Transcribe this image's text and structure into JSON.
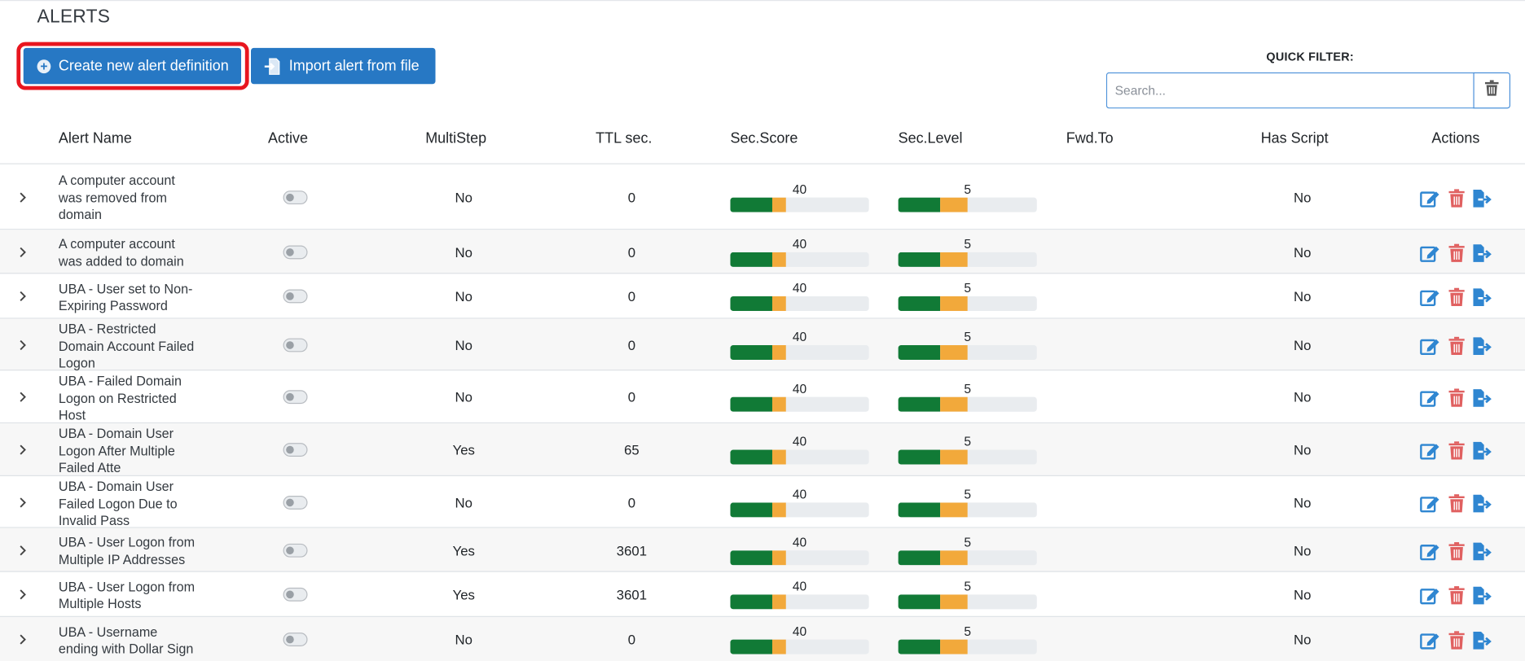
{
  "page": {
    "title": "ALERTS"
  },
  "toolbar": {
    "create_label": "Create new alert definition",
    "import_label": "Import alert from file"
  },
  "quick_filter": {
    "label": "QUICK FILTER:",
    "placeholder": "Search..."
  },
  "columns": {
    "name": "Alert Name",
    "active": "Active",
    "multistep": "MultiStep",
    "ttl": "TTL sec.",
    "sec_score": "Sec.Score",
    "sec_level": "Sec.Level",
    "fwd_to": "Fwd.To",
    "has_script": "Has Script",
    "actions": "Actions"
  },
  "colors": {
    "primary": "#2778c4",
    "highlight": "#e8161f",
    "bar_green": "#117a36",
    "bar_orange": "#f2a93b",
    "edit_icon": "#2f86d1",
    "delete_icon": "#e06060"
  },
  "icons": [
    "plus-circle-icon",
    "import-file-icon",
    "trash-icon",
    "chevron-right-icon",
    "edit-icon",
    "delete-icon",
    "export-icon"
  ],
  "rows": [
    {
      "name_lines": [
        "A computer account",
        "was removed from",
        "domain"
      ],
      "active": false,
      "multistep": "No",
      "ttl": "0",
      "sec_score": "40",
      "sec_level": "5",
      "fwd_to": "",
      "has_script": "No"
    },
    {
      "name_lines": [
        "A computer account",
        "was added to domain"
      ],
      "active": false,
      "multistep": "No",
      "ttl": "0",
      "sec_score": "40",
      "sec_level": "5",
      "fwd_to": "",
      "has_script": "No"
    },
    {
      "name_lines": [
        "UBA - User set to Non-",
        "Expiring Password"
      ],
      "active": false,
      "multistep": "No",
      "ttl": "0",
      "sec_score": "40",
      "sec_level": "5",
      "fwd_to": "",
      "has_script": "No"
    },
    {
      "name_lines": [
        "UBA - Restricted",
        "Domain Account Failed",
        "Logon"
      ],
      "active": false,
      "multistep": "No",
      "ttl": "0",
      "sec_score": "40",
      "sec_level": "5",
      "fwd_to": "",
      "has_script": "No"
    },
    {
      "name_lines": [
        "UBA - Failed Domain",
        "Logon on Restricted",
        "Host"
      ],
      "active": false,
      "multistep": "No",
      "ttl": "0",
      "sec_score": "40",
      "sec_level": "5",
      "fwd_to": "",
      "has_script": "No"
    },
    {
      "name_lines": [
        "UBA - Domain User",
        "Logon After Multiple",
        "Failed Atte"
      ],
      "active": false,
      "multistep": "Yes",
      "ttl": "65",
      "sec_score": "40",
      "sec_level": "5",
      "fwd_to": "",
      "has_script": "No"
    },
    {
      "name_lines": [
        "UBA - Domain User",
        "Failed Logon Due to",
        "Invalid Pass"
      ],
      "active": false,
      "multistep": "No",
      "ttl": "0",
      "sec_score": "40",
      "sec_level": "5",
      "fwd_to": "",
      "has_script": "No"
    },
    {
      "name_lines": [
        "UBA - User Logon from",
        "Multiple IP Addresses"
      ],
      "active": false,
      "multistep": "Yes",
      "ttl": "3601",
      "sec_score": "40",
      "sec_level": "5",
      "fwd_to": "",
      "has_script": "No"
    },
    {
      "name_lines": [
        "UBA - User Logon from",
        "Multiple Hosts"
      ],
      "active": false,
      "multistep": "Yes",
      "ttl": "3601",
      "sec_score": "40",
      "sec_level": "5",
      "fwd_to": "",
      "has_script": "No"
    },
    {
      "name_lines": [
        "UBA - Username",
        "ending with Dollar Sign"
      ],
      "active": false,
      "multistep": "No",
      "ttl": "0",
      "sec_score": "40",
      "sec_level": "5",
      "fwd_to": "",
      "has_script": "No"
    }
  ]
}
